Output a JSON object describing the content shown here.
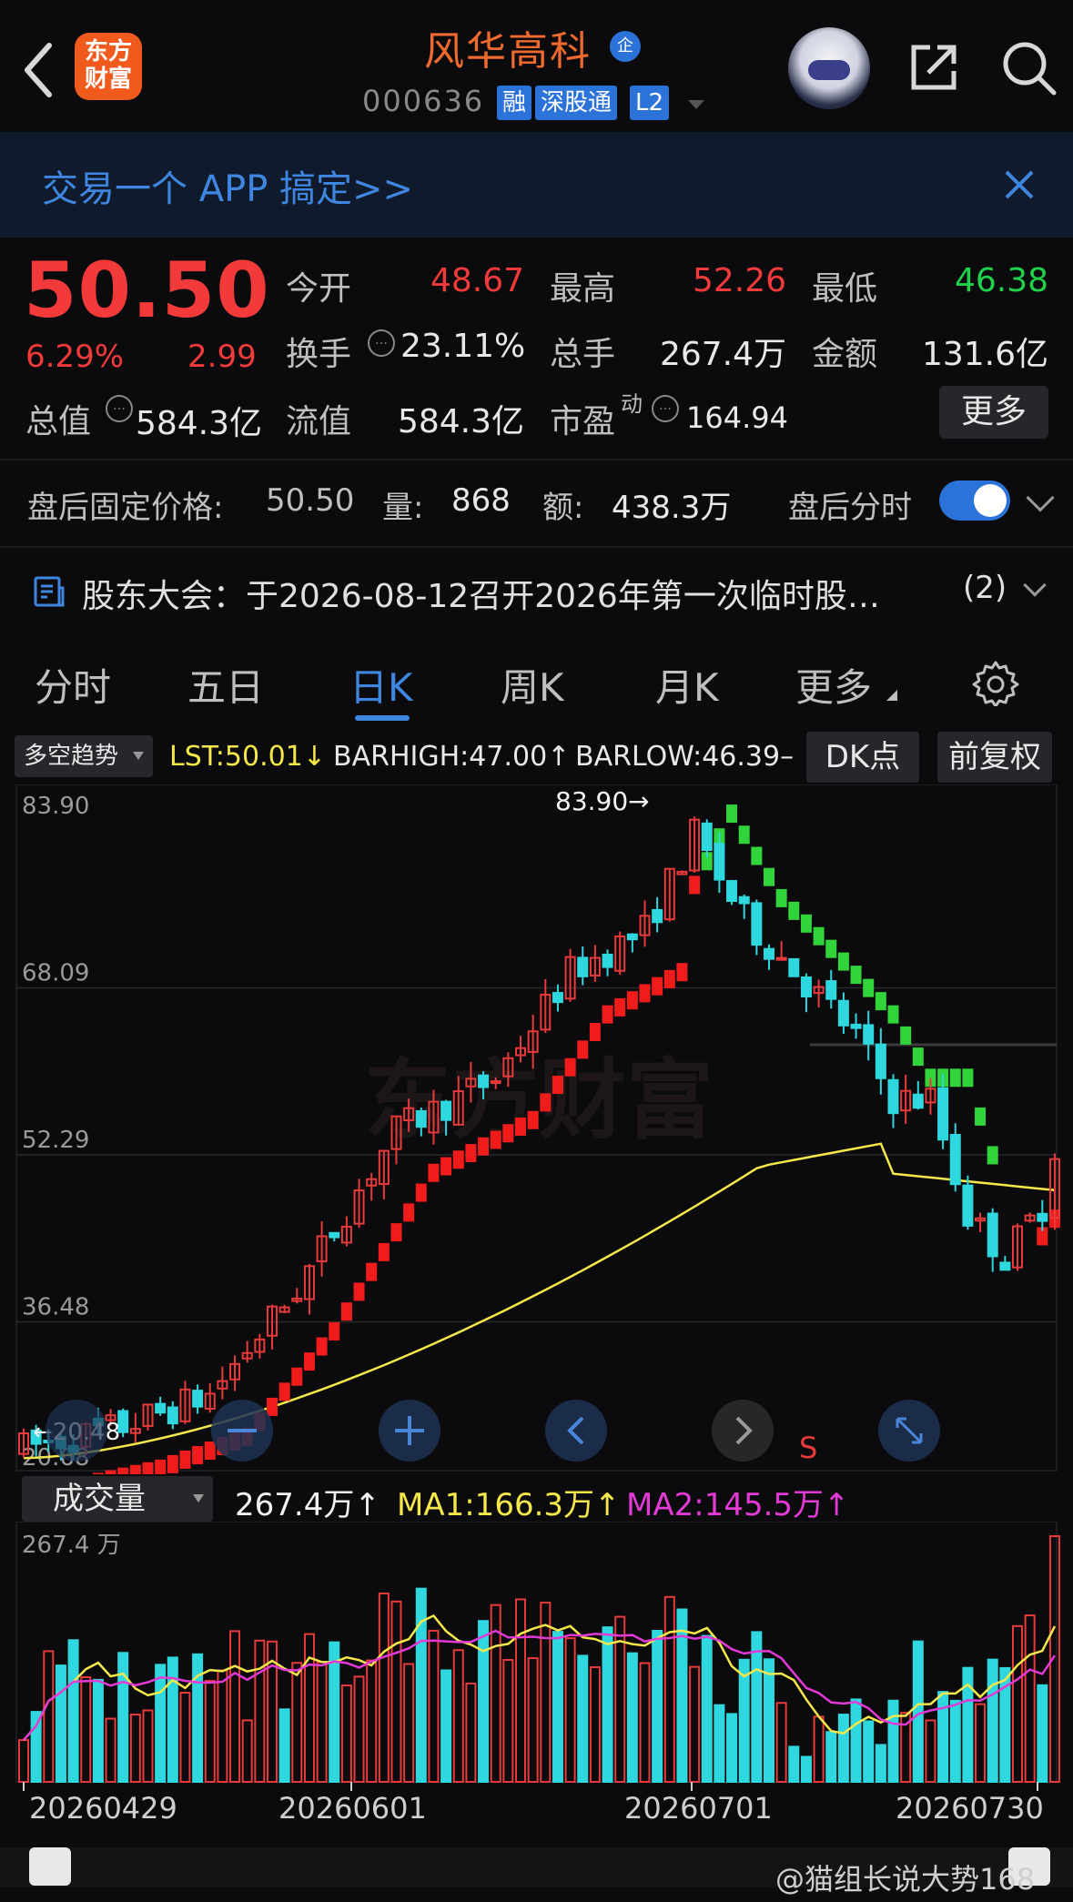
{
  "header": {
    "logo_line1": "东方",
    "logo_line2": "财富",
    "stock_name": "风华高科",
    "name_badge": "企",
    "code": "000636",
    "tags": [
      "融",
      "深股通",
      "L2"
    ]
  },
  "banner": {
    "text": "交易一个 APP 搞定>>"
  },
  "quote": {
    "price": "50.50",
    "change_pct": "6.29%",
    "change_amt": "2.99",
    "fields": {
      "open_label": "今开",
      "open": "48.67",
      "high_label": "最高",
      "high": "52.26",
      "low_label": "最低",
      "low": "46.38",
      "turnover_label": "换手",
      "turnover": "23.11%",
      "volume_label": "总手",
      "volume": "267.4万",
      "amount_label": "金额",
      "amount": "131.6亿",
      "mktcap_label": "总值",
      "mktcap": "584.3亿",
      "float_label": "流值",
      "float": "584.3亿",
      "pe_label": "市盈",
      "pe_sup": "动",
      "pe": "164.94"
    },
    "more_button": "更多"
  },
  "after_hours": {
    "label": "盘后固定价格:",
    "price": "50.50",
    "vol_label": "量:",
    "vol": "868",
    "amt_label": "额:",
    "amt": "438.3万",
    "toggle_label": "盘后分时"
  },
  "notice": {
    "text": "股东大会：于2026-08-12召开2026年第一次临时股…",
    "count": "(2)"
  },
  "tabs": [
    "分时",
    "五日",
    "日K",
    "周K",
    "月K",
    "更多"
  ],
  "indicator": {
    "dropdown": "多空趋势",
    "lst": "LST:50.01↓",
    "barhigh": "BARHIGH:47.00↑",
    "barlow": "BARLOW:46.39–",
    "dk_button": "DK点",
    "adjust_button": "前复权"
  },
  "chart_data": {
    "type": "candlestick",
    "y_ticks": [
      "83.90",
      "68.09",
      "52.29",
      "36.48",
      "20.68"
    ],
    "ylim": [
      20.68,
      83.9
    ],
    "max_annotation": "83.90→",
    "min_annotation": "←20.48",
    "signal_label": "S",
    "watermark": "东方财富",
    "x_ticks": [
      "20260429",
      "20260601",
      "20260701",
      "20260730"
    ],
    "volume": {
      "dropdown": "成交量",
      "value": "267.4万↑",
      "ma1": "MA1:166.3万↑",
      "ma2": "MA2:145.5万↑",
      "top_label": "267.4 万"
    }
  },
  "colors": {
    "up": "#e83a3a",
    "down": "#2fd7de",
    "accent": "#2b73d8",
    "ma1": "#f5e84a",
    "ma2": "#e33ad6"
  },
  "footer": {
    "watermark": "@猫组长说大势168"
  }
}
